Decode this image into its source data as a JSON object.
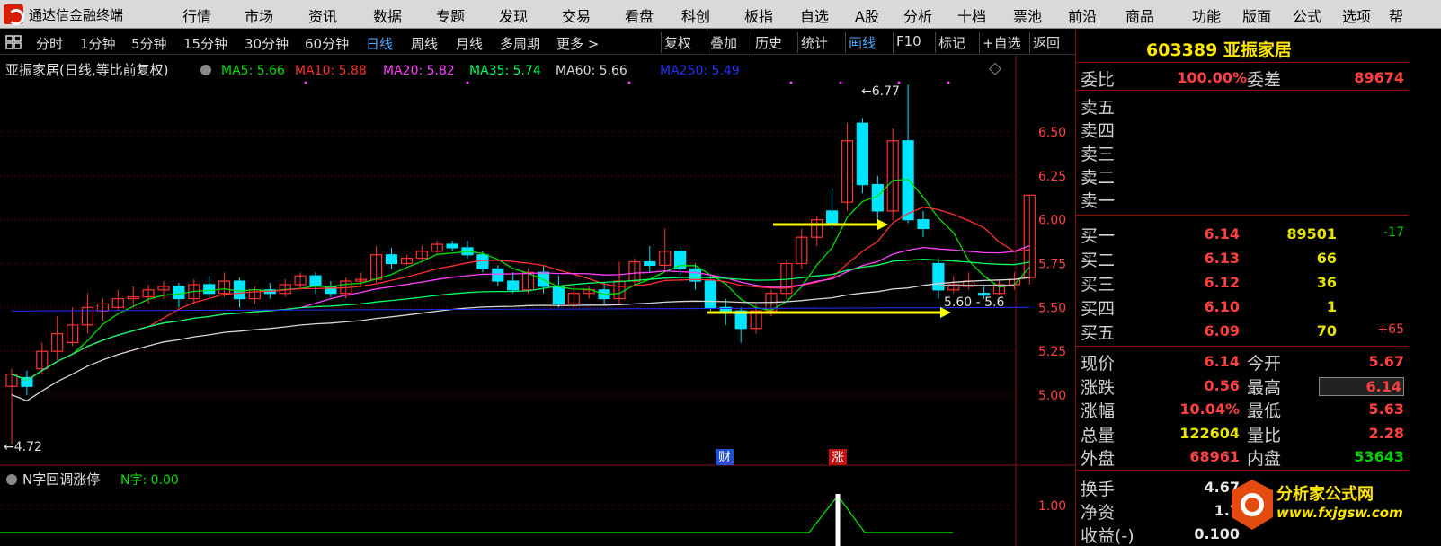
{
  "app": {
    "title": "通达信金融终端"
  },
  "menu": [
    "行情",
    "市场",
    "资讯",
    "数据",
    "专题",
    "发现",
    "交易",
    "看盘",
    "科创",
    "板指",
    "自选",
    "A股",
    "分析",
    "十档",
    "票池",
    "前沿",
    "商品",
    "功能",
    "版面",
    "公式",
    "选项",
    "帮"
  ],
  "toolbar": {
    "periods": [
      "分时",
      "1分钟",
      "5分钟",
      "15分钟",
      "30分钟",
      "60分钟",
      "日线",
      "周线",
      "月线",
      "多周期",
      "更多 >"
    ],
    "active_period": "日线",
    "buttons": [
      "复权",
      "叠加",
      "历史",
      "统计",
      "画线",
      "F10",
      "标记",
      "+自选",
      "返回"
    ],
    "active_button": "画线"
  },
  "chart": {
    "title": "亚振家居(日线,等比前复权)",
    "ma_labels": [
      {
        "text": "MA5: 5.66",
        "color": "#00e000"
      },
      {
        "text": "MA10: 5.88",
        "color": "#ff3030"
      },
      {
        "text": "MA20: 5.82",
        "color": "#ff40ff"
      },
      {
        "text": "MA35: 5.74",
        "color": "#00ff60"
      },
      {
        "text": "MA60: 5.66",
        "color": "#d8d8d8"
      },
      {
        "text": "MA250: 5.49",
        "color": "#2030ff"
      }
    ],
    "price_axis": [
      "6.50",
      "6.25",
      "6.00",
      "5.75",
      "5.50",
      "5.25",
      "5.00"
    ],
    "high_marker": "6.77",
    "low_marker": "4.72",
    "range_label": "5.60 - 5.6",
    "event_tags": [
      "财",
      "涨"
    ],
    "colors": {
      "up": "#ff3232",
      "down": "#00e5ff",
      "grid": "#7a0000"
    }
  },
  "indicator": {
    "title": "N字回调涨停",
    "value_label": "N字: 0.00",
    "axis": [
      "1.00"
    ]
  },
  "quote_panel": {
    "stock": "603389 亚振家居",
    "weibi": {
      "label": "委比",
      "value": "100.00%",
      "diff_label": "委差",
      "diff_value": "89674"
    },
    "sell": [
      {
        "label": "卖五"
      },
      {
        "label": "卖四"
      },
      {
        "label": "卖三"
      },
      {
        "label": "卖二"
      },
      {
        "label": "卖一"
      }
    ],
    "buy": [
      {
        "label": "买一",
        "price": "6.14",
        "vol": "89501",
        "chg": "-17"
      },
      {
        "label": "买二",
        "price": "6.13",
        "vol": "66",
        "chg": ""
      },
      {
        "label": "买三",
        "price": "6.12",
        "vol": "36",
        "chg": ""
      },
      {
        "label": "买四",
        "price": "6.10",
        "vol": "1",
        "chg": ""
      },
      {
        "label": "买五",
        "price": "6.09",
        "vol": "70",
        "chg": "+65"
      }
    ],
    "stats": [
      {
        "l1": "现价",
        "v1": "6.14",
        "c1": "red",
        "l2": "今开",
        "v2": "5.67",
        "c2": "red"
      },
      {
        "l1": "涨跌",
        "v1": "0.56",
        "c1": "red",
        "l2": "最高",
        "v2": "6.14",
        "c2": "red"
      },
      {
        "l1": "涨幅",
        "v1": "10.04%",
        "c1": "red",
        "l2": "最低",
        "v2": "5.63",
        "c2": "red"
      },
      {
        "l1": "总量",
        "v1": "122604",
        "c1": "yellow",
        "l2": "量比",
        "v2": "2.28",
        "c2": "red"
      },
      {
        "l1": "外盘",
        "v1": "68961",
        "c1": "red",
        "l2": "内盘",
        "v2": "53643",
        "c2": "green"
      }
    ],
    "extra": [
      {
        "l1": "换手",
        "v1": "4.67"
      },
      {
        "l1": "净资",
        "v1": "1.7"
      },
      {
        "l1": "收益(-)",
        "v1": "0.100"
      }
    ]
  },
  "watermark": {
    "text": "分析家公式网",
    "url": "www.fxjgsw.com"
  }
}
